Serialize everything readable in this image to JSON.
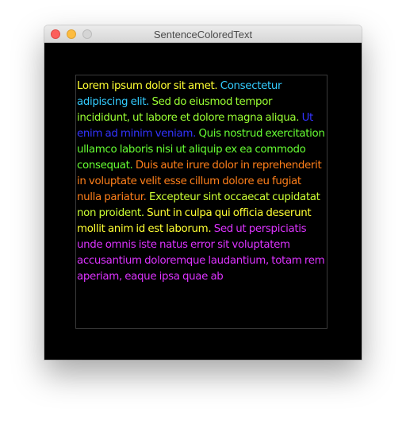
{
  "window": {
    "title": "SentenceColoredText"
  },
  "colors": {
    "background": "#000000",
    "close": "#fc605c",
    "minimize": "#fdbc40",
    "zoom": "#d5d5d5"
  },
  "sentences": [
    {
      "text": "Lorem ipsum dolor sit amet.",
      "color": "#ffff33"
    },
    {
      "text": "Consectetur adipiscing elit.",
      "color": "#33ccff"
    },
    {
      "text": "Sed do eiusmod tempor incididunt, ut labore et dolore magna aliqua.",
      "color": "#99ff33"
    },
    {
      "text": "Ut enim ad minim veniam.",
      "color": "#3333ff"
    },
    {
      "text": "Quis nostrud exercitation ullamco laboris nisi ut aliquip ex ea commodo consequat.",
      "color": "#66ff33"
    },
    {
      "text": "Duis aute irure dolor in reprehenderit in voluptate velit esse cillum dolore eu fugiat nulla pariatur.",
      "color": "#ff7f1a"
    },
    {
      "text": "Excepteur sint occaecat cupidatat non proident.",
      "color": "#ccff33"
    },
    {
      "text": "Sunt in culpa qui officia deserunt mollit anim id est laborum.",
      "color": "#ffff33"
    },
    {
      "text": "Sed ut perspiciatis unde omnis iste natus error sit voluptatem accusantium doloremque laudantium, totam rem aperiam, eaque ipsa quae ab",
      "color": "#dd33ff"
    }
  ]
}
